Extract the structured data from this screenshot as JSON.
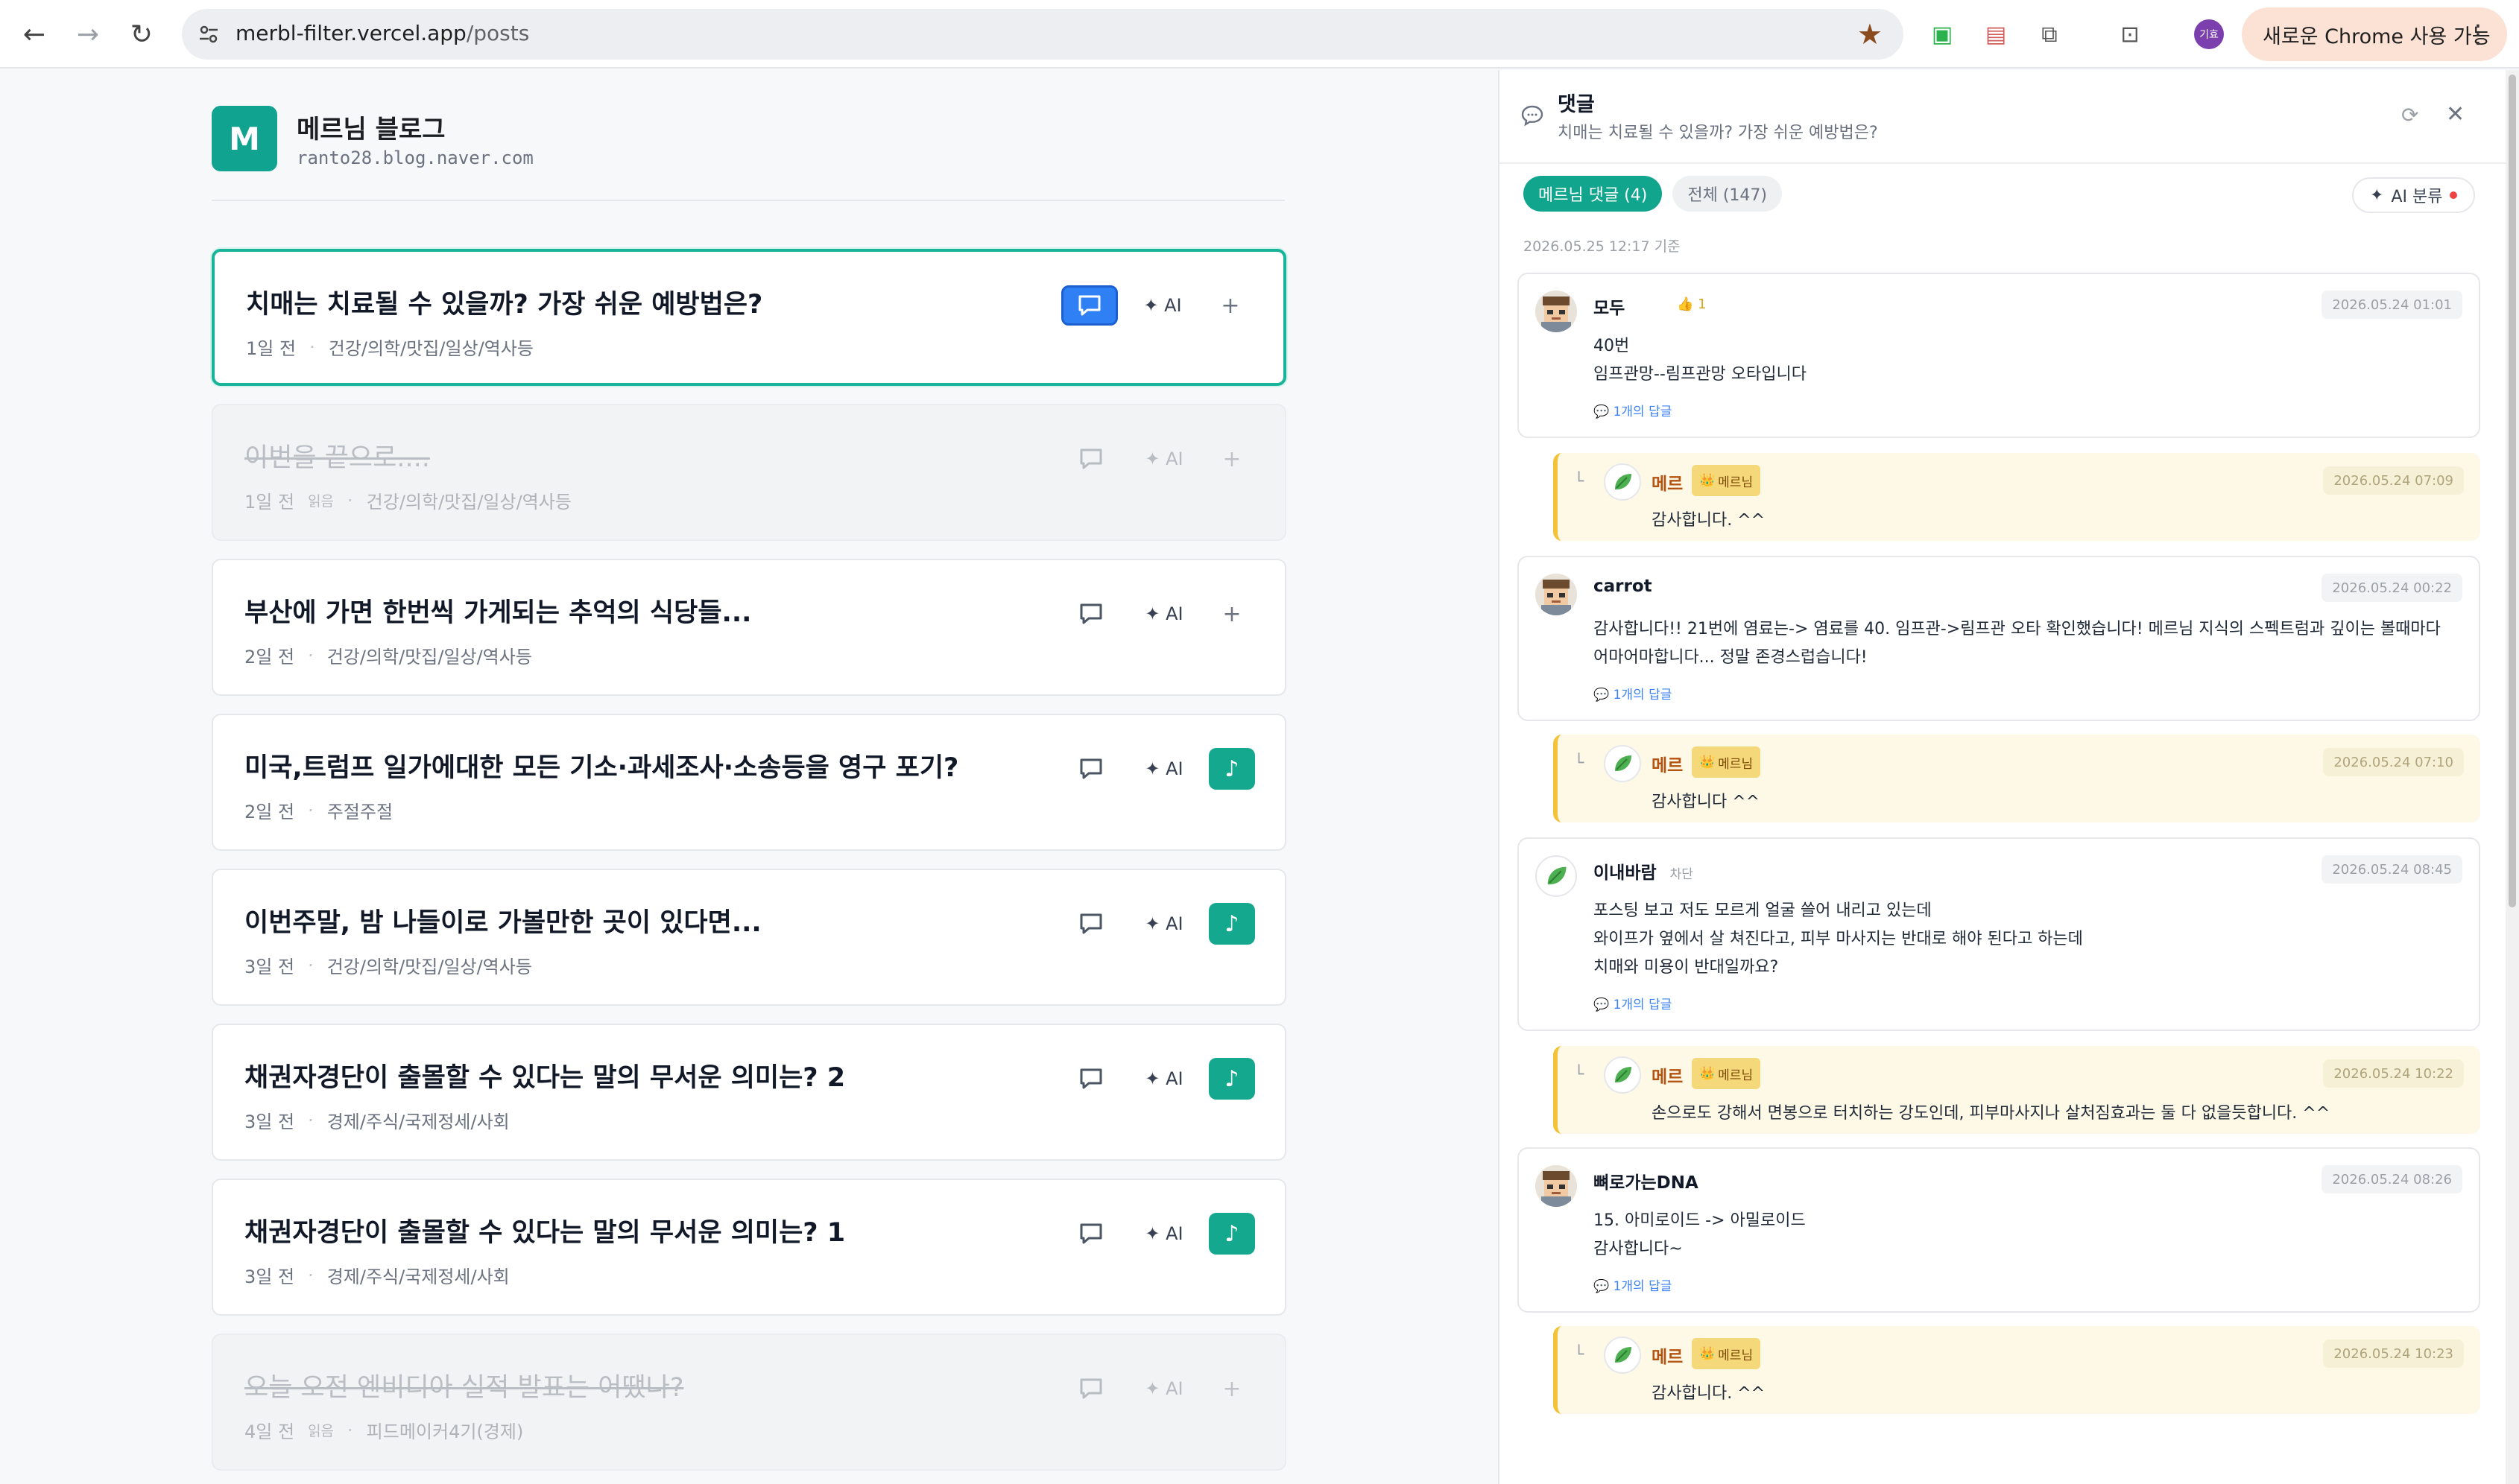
{
  "browser": {
    "url_host": "merbl-filter.vercel.app",
    "url_path": "/posts",
    "profile_initials": "기효",
    "chrome_badge": "새로운 Chrome 사용 가능"
  },
  "blog": {
    "logo_letter": "M",
    "title": "메르님 블로그",
    "domain": "ranto28.blog.naver.com"
  },
  "posts": [
    {
      "title": "치매는 치료될 수 있을까? 가장 쉬운 예방법은?",
      "age": "1일 전",
      "read_tag": "",
      "category": "건강/의학/맛집/일상/역사등",
      "ai_label": "AI",
      "extra": "+",
      "state": "selected"
    },
    {
      "title": "이번을 끝으로....",
      "age": "1일 전",
      "read_tag": "읽음",
      "category": "건강/의학/맛집/일상/역사등",
      "ai_label": "AI",
      "extra": "+",
      "state": "read"
    },
    {
      "title": "부산에 가면 한번씩 가게되는 추억의 식당들...",
      "age": "2일 전",
      "read_tag": "",
      "category": "건강/의학/맛집/일상/역사등",
      "ai_label": "AI",
      "extra": "+",
      "state": "normal"
    },
    {
      "title": "미국,트럼프 일가에대한 모든 기소·과세조사·소송등을 영구 포기?",
      "age": "2일 전",
      "read_tag": "",
      "category": "주절주절",
      "ai_label": "AI",
      "extra": "♪",
      "state": "music"
    },
    {
      "title": "이번주말, 밤 나들이로 가볼만한 곳이 있다면...",
      "age": "3일 전",
      "read_tag": "",
      "category": "건강/의학/맛집/일상/역사등",
      "ai_label": "AI",
      "extra": "♪",
      "state": "music"
    },
    {
      "title": "채권자경단이 출몰할 수 있다는 말의 무서운 의미는? 2",
      "age": "3일 전",
      "read_tag": "",
      "category": "경제/주식/국제정세/사회",
      "ai_label": "AI",
      "extra": "♪",
      "state": "music"
    },
    {
      "title": "채권자경단이 출몰할 수 있다는 말의 무서운 의미는? 1",
      "age": "3일 전",
      "read_tag": "",
      "category": "경제/주식/국제정세/사회",
      "ai_label": "AI",
      "extra": "♪",
      "state": "music"
    },
    {
      "title": "오늘 오전 엔비디아 실적 발표는 어땠나?",
      "age": "4일 전",
      "read_tag": "읽음",
      "category": "피드메이커4기(경제)",
      "ai_label": "AI",
      "extra": "+",
      "state": "read"
    }
  ],
  "panel": {
    "title": "댓글",
    "subtitle": "치매는 치료될 수 있을까? 가장 쉬운 예방법은?",
    "tab_author": "메르님 댓글 (4)",
    "tab_all": "전체 (147)",
    "ai_sort": "AI 분류",
    "as_of": "2026.05.25 12:17 기준"
  },
  "comments": [
    {
      "author": "모두",
      "like": "1",
      "blocked": "",
      "date": "2026.05.24 01:01",
      "lines": [
        "40번",
        "임프관망--림프관망 오타입니다"
      ],
      "replies": "1개의 답글",
      "avatar": "pixel"
    },
    {
      "author": "carrot",
      "like": "",
      "blocked": "",
      "date": "2026.05.24 00:22",
      "lines": [
        "감사합니다!! 21번에 염료는-> 염료를 40. 임프관->림프관 오타 확인했습니다! 메르님 지식의 스펙트럼과 깊이는 볼때마다",
        "어마어마합니다... 정말 존경스럽습니다!"
      ],
      "replies": "1개의 답글",
      "avatar": "pixel"
    },
    {
      "author": "이내바람",
      "like": "",
      "blocked": "차단",
      "date": "2026.05.24 08:45",
      "lines": [
        "포스팅 보고 저도 모르게 얼굴 쓸어 내리고 있는데",
        "와이프가 옆에서 살 쳐진다고, 피부 마사지는 반대로 해야 된다고 하는데",
        "치매와 미용이 반대일까요?"
      ],
      "replies": "1개의 답글",
      "avatar": "leaf"
    },
    {
      "author": "뼈로가는DNA",
      "like": "",
      "blocked": "",
      "date": "2026.05.24 08:26",
      "lines": [
        "15. 아미로이드 -> 아밀로이드",
        "감사합니다~"
      ],
      "replies": "1개의 답글",
      "avatar": "pixel"
    }
  ],
  "replies": [
    {
      "author": "메르",
      "badge": "메르님",
      "date": "2026.05.24 07:09",
      "text": "감사합니다. ^^"
    },
    {
      "author": "메르",
      "badge": "메르님",
      "date": "2026.05.24 07:10",
      "text": "감사합니다 ^^"
    },
    {
      "author": "메르",
      "badge": "메르님",
      "date": "2026.05.24 10:22",
      "text": "손으로도 강해서 면봉으로 터치하는 강도인데, 피부마사지나 살처짐효과는 둘 다 없을듯합니다. ^^"
    },
    {
      "author": "메르",
      "badge": "메르님",
      "date": "2026.05.24 10:23",
      "text": "감사합니다. ^^"
    }
  ]
}
